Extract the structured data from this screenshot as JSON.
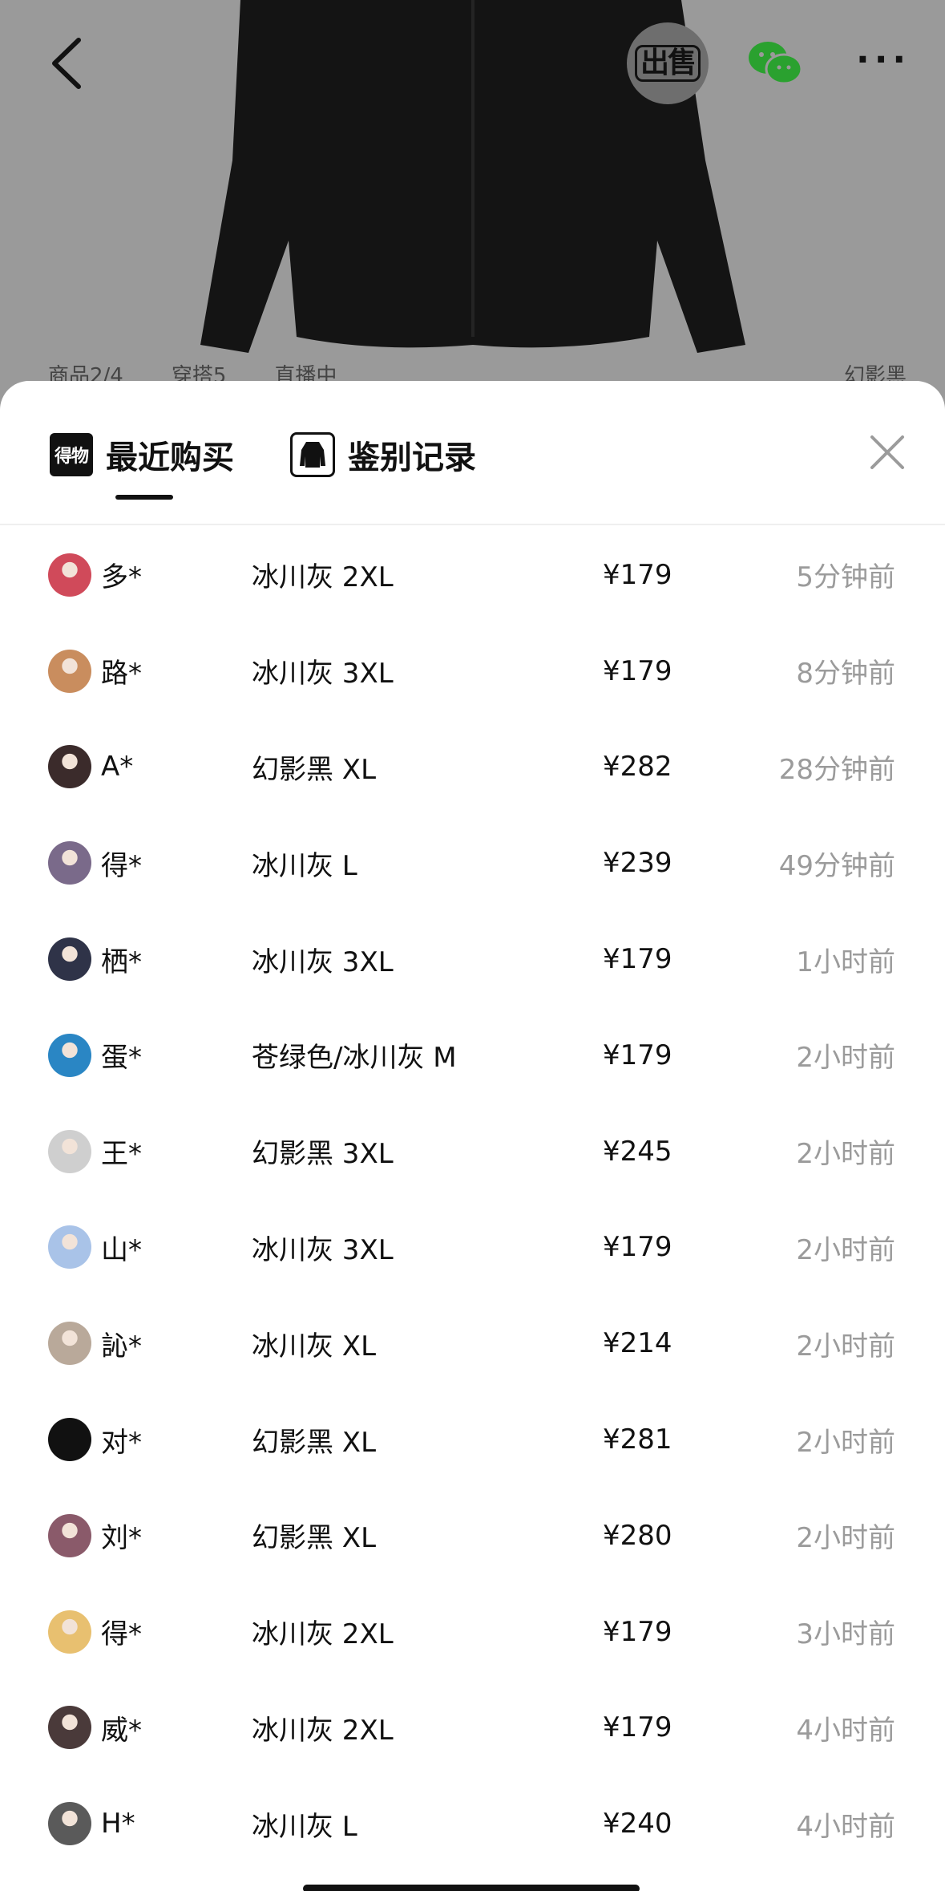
{
  "background": {
    "sell_label": "出售",
    "strip": [
      "商品2/4",
      "穿搭5",
      "直播中",
      "幻影黑"
    ]
  },
  "sheet": {
    "tabs": [
      {
        "label": "最近购买",
        "badge": "得物",
        "active": true
      },
      {
        "label": "鉴别记录",
        "active": false
      }
    ]
  },
  "purchases": [
    {
      "name": "多*",
      "spec": "冰川灰 2XL",
      "price": "¥179",
      "time": "5分钟前",
      "avatar_color": "#d04a5a"
    },
    {
      "name": "路*",
      "spec": "冰川灰 3XL",
      "price": "¥179",
      "time": "8分钟前",
      "avatar_color": "#c98d5e"
    },
    {
      "name": "A*",
      "spec": "幻影黑 XL",
      "price": "¥282",
      "time": "28分钟前",
      "avatar_color": "#3b2b2b"
    },
    {
      "name": "得*",
      "spec": "冰川灰 L",
      "price": "¥239",
      "time": "49分钟前",
      "avatar_color": "#7a6a8a"
    },
    {
      "name": "栖*",
      "spec": "冰川灰 3XL",
      "price": "¥179",
      "time": "1小时前",
      "avatar_color": "#2f3348"
    },
    {
      "name": "蛋*",
      "spec": "苍绿色/冰川灰 M",
      "price": "¥179",
      "time": "2小时前",
      "avatar_color": "#2a86c4"
    },
    {
      "name": "王*",
      "spec": "幻影黑 3XL",
      "price": "¥245",
      "time": "2小时前",
      "avatar_color": "#cfcfcf"
    },
    {
      "name": "山*",
      "spec": "冰川灰 3XL",
      "price": "¥179",
      "time": "2小时前",
      "avatar_color": "#a9c3e8"
    },
    {
      "name": "訫*",
      "spec": "冰川灰 XL",
      "price": "¥214",
      "time": "2小时前",
      "avatar_color": "#b9a99a"
    },
    {
      "name": "对*",
      "spec": "幻影黑 XL",
      "price": "¥281",
      "time": "2小时前",
      "avatar_color": "#111111"
    },
    {
      "name": "刘*",
      "spec": "幻影黑 XL",
      "price": "¥280",
      "time": "2小时前",
      "avatar_color": "#8a5a6a"
    },
    {
      "name": "得*",
      "spec": "冰川灰 2XL",
      "price": "¥179",
      "time": "3小时前",
      "avatar_color": "#e8c070"
    },
    {
      "name": "威*",
      "spec": "冰川灰 2XL",
      "price": "¥179",
      "time": "4小时前",
      "avatar_color": "#4a3a3a"
    },
    {
      "name": "H*",
      "spec": "冰川灰 L",
      "price": "¥240",
      "time": "4小时前",
      "avatar_color": "#5a5a5a"
    }
  ],
  "colors": {
    "overlay": "#9a9a9a",
    "sheet": "#ffffff",
    "text": "#111111",
    "muted": "#9b9b9b",
    "wechat_green": "#2aa12f"
  },
  "icons": [
    "back-chevron-icon",
    "wechat-icon",
    "more-icon",
    "close-icon",
    "jacket-thumb-icon"
  ]
}
